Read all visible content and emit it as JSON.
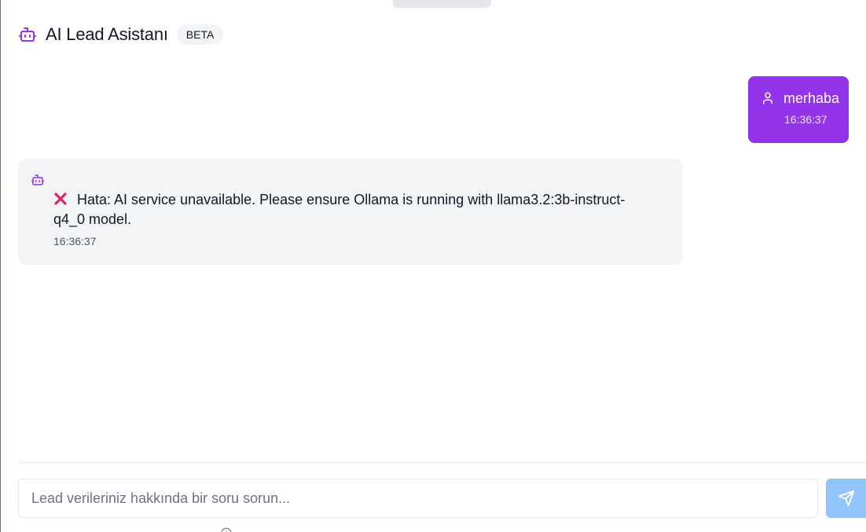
{
  "header": {
    "title": "AI Lead Asistanı",
    "badge": "BETA",
    "icon": "bot-icon",
    "accent_color": "#9333ea"
  },
  "messages": [
    {
      "role": "user",
      "icon": "user-icon",
      "text": "merhaba",
      "time": "16:36:37",
      "bubble_color": "#9333ea"
    },
    {
      "role": "assistant",
      "icon": "bot-icon",
      "status_icon": "error-x-icon",
      "text": "Hata: AI service unavailable. Please ensure Ollama is running with llama3.2:3b-instruct-q4_0 model.",
      "time": "16:36:37",
      "bubble_color": "#f3f4f6"
    }
  ],
  "composer": {
    "placeholder": "Lead verileriniz hakkında bir soru sorun...",
    "value": "",
    "send_icon": "send-icon",
    "send_color": "#93c5fd"
  },
  "footer": {
    "icon": "info-icon"
  }
}
